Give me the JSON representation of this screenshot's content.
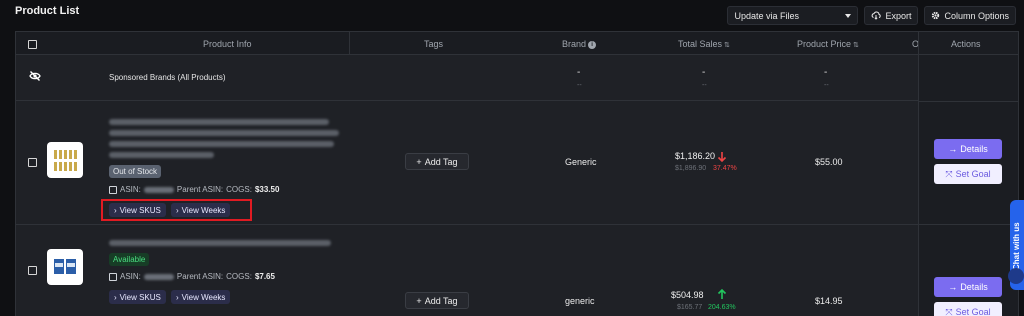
{
  "page": {
    "title": "Product List"
  },
  "toolbar": {
    "update_select": "Update via Files",
    "export_label": "Export",
    "column_options_label": "Column Options"
  },
  "table": {
    "headers": {
      "product_info": "Product Info",
      "tags": "Tags",
      "brand": "Brand",
      "total_sales": "Total Sales",
      "product_price": "Product Price",
      "truncated": "O",
      "actions": "Actions"
    },
    "sponsored": {
      "label": "Sponsored Brands (All Products)",
      "brand": "-",
      "brand_sub": "--",
      "sales": "-",
      "sales_sub": "--",
      "price": "-",
      "price_sub": "--"
    },
    "products": [
      {
        "status": "Out of Stock",
        "asin_label": "ASIN:",
        "parent_asin_label": "Parent ASIN:",
        "cogs_label": "COGS:",
        "cogs_value": "$33.50",
        "view_skus": "View SKUS",
        "view_weeks": "View Weeks",
        "tag_button": "Add Tag",
        "brand": "Generic",
        "sales": "$1,186.20",
        "sales_prev": "$1,896.90",
        "sales_pct": "37.47%",
        "trend": "down",
        "price": "$55.00",
        "details": "Details",
        "set_goal": "Set Goal"
      },
      {
        "status": "Available",
        "asin_label": "ASIN:",
        "parent_asin_label": "Parent ASIN:",
        "cogs_label": "COGS:",
        "cogs_value": "$7.65",
        "view_skus": "View SKUS",
        "view_weeks": "View Weeks",
        "tag_button": "Add Tag",
        "brand": "generic",
        "sales": "$504.98",
        "sales_prev": "$165.77",
        "sales_pct": "204.63%",
        "trend": "up",
        "price": "$14.95",
        "details": "Details",
        "set_goal": "Set Goal"
      }
    ]
  },
  "chat": {
    "label": "Chat with us"
  },
  "colors": {
    "accent": "#7b6cf0",
    "down": "#ef4444",
    "up": "#22c55e",
    "highlight": "#e01b22"
  },
  "icons": [
    "eye-off-icon",
    "cloud-download-icon",
    "gear-icon",
    "chevron-down-icon",
    "info-icon",
    "sort-icon",
    "external-link-icon",
    "arrow-right-icon",
    "target-icon",
    "plus-icon",
    "arrow-down-icon",
    "arrow-up-icon",
    "chat-icon"
  ]
}
